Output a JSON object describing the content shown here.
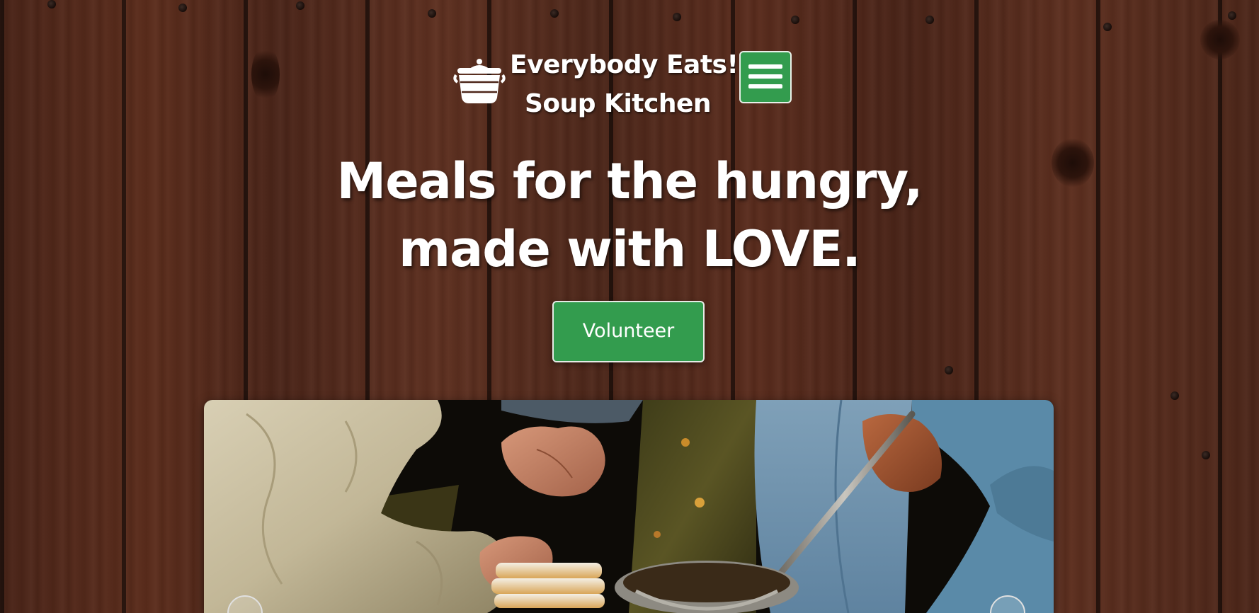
{
  "brand": {
    "line1": "Everybody Eats!",
    "line2": "Soup Kitchen",
    "logo_icon": "soup-pot-icon"
  },
  "nav": {
    "menu_icon": "hamburger-menu-icon",
    "menu_color": "#339c4e"
  },
  "hero": {
    "title_line1": "Meals for the hungry,",
    "title_line2": "made with LOVE.",
    "cta_label": "Volunteer",
    "cta_color": "#339c4e"
  },
  "image": {
    "subject": "hands-serving-bread-and-soup-photo"
  }
}
